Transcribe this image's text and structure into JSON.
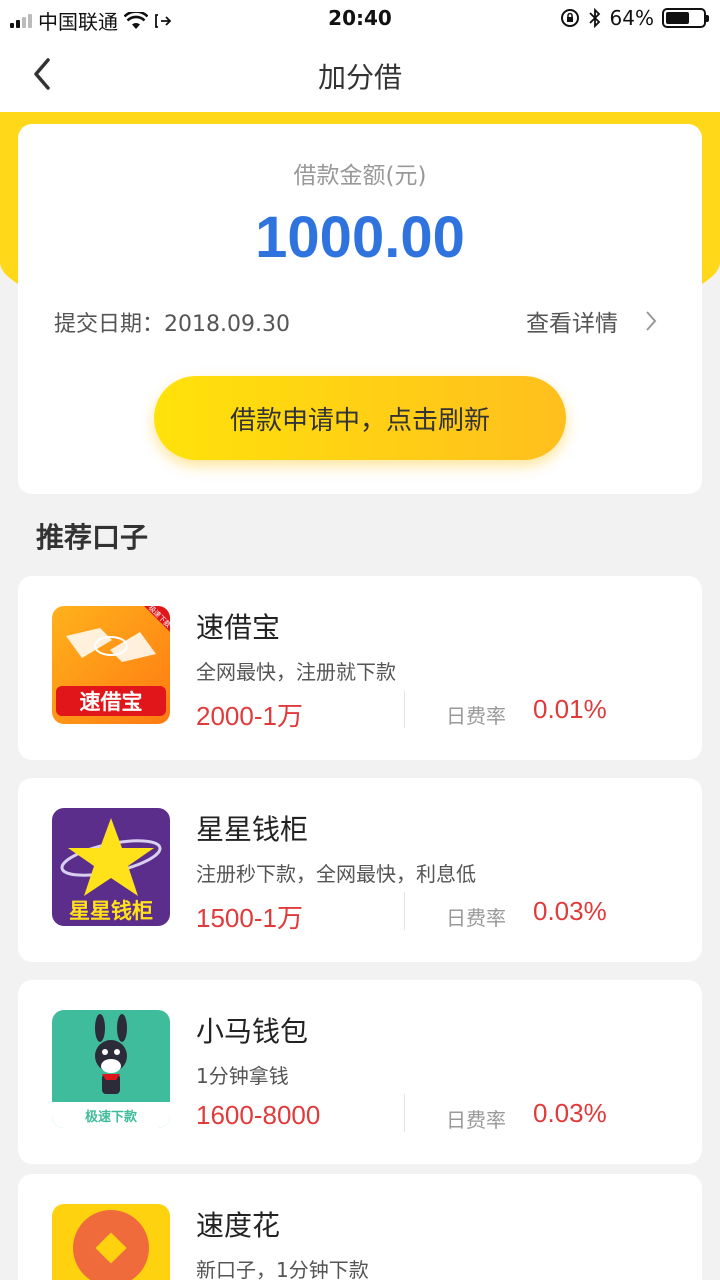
{
  "status_bar": {
    "carrier": "中国联通",
    "time": "20:40",
    "battery_percent": "64%",
    "battery_level": 0.64,
    "icons": [
      "signal-icon",
      "wifi-icon",
      "location-icon",
      "orientation-lock-icon",
      "bluetooth-icon",
      "battery-icon"
    ]
  },
  "nav": {
    "title": "加分借",
    "back_icon": "chevron-left-icon"
  },
  "loan": {
    "label": "借款金额(元)",
    "amount": "1000.00",
    "submit_date": "提交日期：2018.09.30",
    "details_link": "查看详情",
    "cta": "借款申请中，点击刷新"
  },
  "section": {
    "title": "推荐口子"
  },
  "products": [
    {
      "name": "速借宝",
      "desc": "全网最快，注册就下款",
      "range": "2000-1万",
      "rate_label": "日费率",
      "rate": "0.01%",
      "logo_text": "速借宝",
      "logo_badge": "极速下款"
    },
    {
      "name": "星星钱柜",
      "desc": "注册秒下款，全网最快，利息低",
      "range": "1500-1万",
      "rate_label": "日费率",
      "rate": "0.03%",
      "logo_text": "星星钱柜"
    },
    {
      "name": "小马钱包",
      "desc": "1分钟拿钱",
      "range": "1600-8000",
      "rate_label": "日费率",
      "rate": "0.03%",
      "logo_text": "极速下款"
    },
    {
      "name": "速度花",
      "desc": "新口子，1分钟下款"
    }
  ],
  "colors": {
    "brand_yellow": "#ffd81a",
    "amount_blue": "#2f74de",
    "accent_red": "#e03a3a"
  }
}
